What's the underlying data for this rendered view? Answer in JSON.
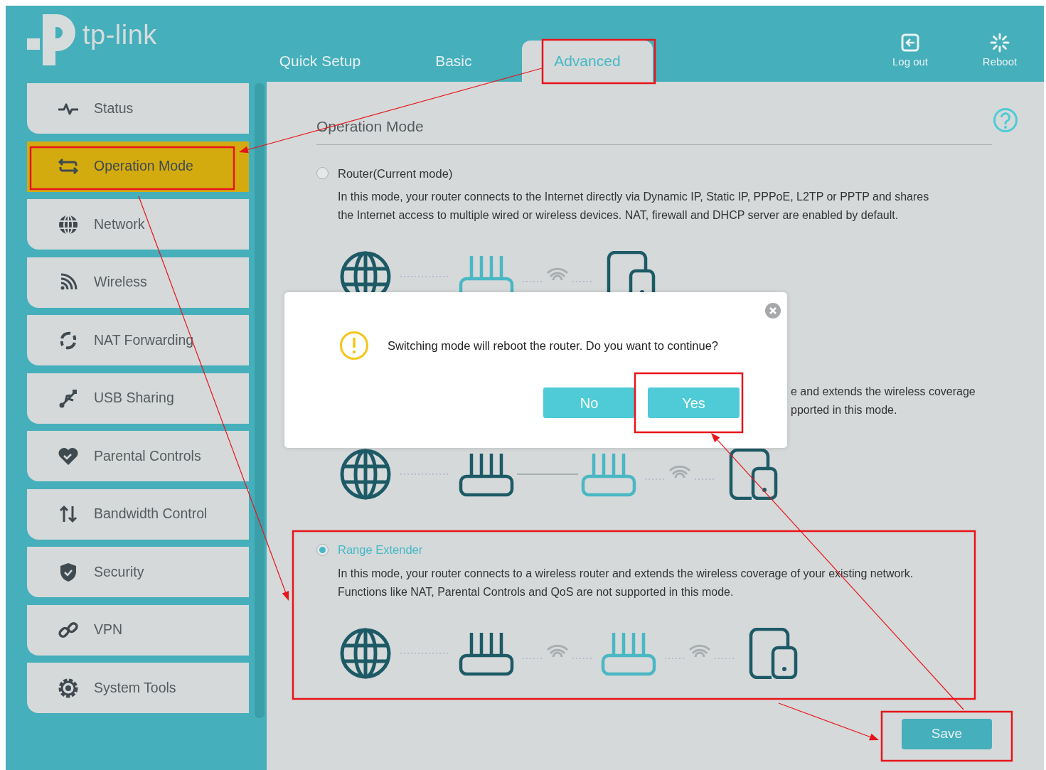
{
  "header": {
    "logo_text": "tp-link",
    "tabs": [
      {
        "label": "Quick Setup",
        "selected": false
      },
      {
        "label": "Basic",
        "selected": false
      },
      {
        "label": "Advanced",
        "selected": true
      }
    ],
    "actions": [
      {
        "kind": "logout",
        "label": "Log out"
      },
      {
        "kind": "reboot",
        "label": "Reboot"
      }
    ]
  },
  "sidebar": {
    "items": [
      {
        "kind": "status",
        "label": "Status",
        "selected": false
      },
      {
        "kind": "swap",
        "label": "Operation Mode",
        "selected": true
      },
      {
        "kind": "globe",
        "label": "Network",
        "selected": false
      },
      {
        "kind": "wifi",
        "label": "Wireless",
        "selected": false
      },
      {
        "kind": "nat",
        "label": "NAT Forwarding",
        "selected": false
      },
      {
        "kind": "usb",
        "label": "USB Sharing",
        "selected": false
      },
      {
        "kind": "heart",
        "label": "Parental Controls",
        "selected": false
      },
      {
        "kind": "updown",
        "label": "Bandwidth Control",
        "selected": false
      },
      {
        "kind": "shield",
        "label": "Security",
        "selected": false
      },
      {
        "kind": "link",
        "label": "VPN",
        "selected": false
      },
      {
        "kind": "gear",
        "label": "System Tools",
        "selected": false
      }
    ]
  },
  "content": {
    "title": "Operation Mode",
    "modes": [
      {
        "label": "Router(Current mode)",
        "selected": false,
        "description": "In this mode, your router connects to the Internet directly via Dynamic IP, Static IP, PPPoE, L2TP or PPTP and shares the Internet access to multiple wired or wireless devices. NAT, firewall and DHCP server are enabled by default."
      },
      {
        "description_lines": [
          "e and extends the wireless coverage",
          "pported in this mode."
        ]
      },
      {
        "label": "Range Extender",
        "selected": true,
        "description": "In this mode, your router connects to a wireless router and extends the wireless coverage of your existing network. Functions like NAT, Parental Controls and QoS are not supported in this mode."
      }
    ],
    "save_button": "Save"
  },
  "dialog": {
    "message": "Switching mode will reboot the router. Do you want to continue?",
    "buttons": [
      "No",
      "Yes"
    ]
  }
}
